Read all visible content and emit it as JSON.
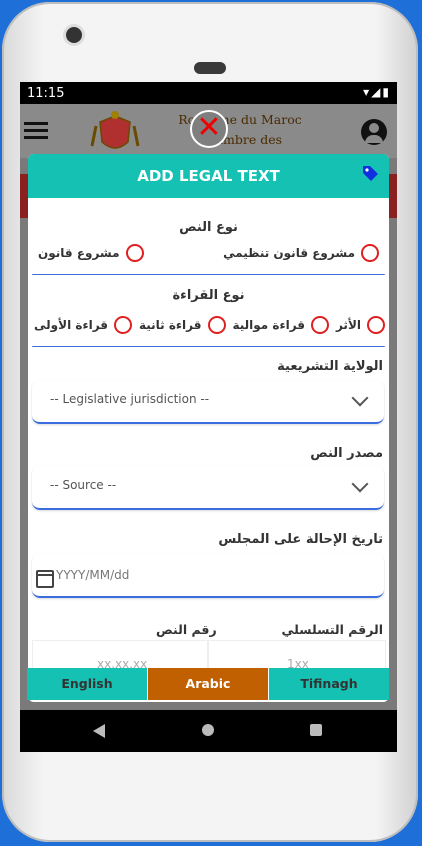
{
  "status": {
    "time": "11:15",
    "icons": "▾◢▮"
  },
  "app": {
    "title_line1": "Royaume du Maroc",
    "title_line2": "Chambre des Représentants",
    "close_glyph": "✕"
  },
  "modal": {
    "title": "ADD LEGAL TEXT",
    "text_type": {
      "label": "نوع النص",
      "options": [
        "مشروع قانون تنظيمي",
        "مشروع قانون"
      ]
    },
    "reading_type": {
      "label": "نوع القراءة",
      "options": [
        "الأثر",
        "قراءة موالية",
        "قراءة ثانية",
        "قراءة الأولى"
      ]
    },
    "jurisdiction": {
      "label": "الولاية التشريعية",
      "placeholder": "-- Legislative jurisdiction --"
    },
    "source": {
      "label": "مصدر النص",
      "placeholder": "-- Source --"
    },
    "referral_date": {
      "label": "تاريخ الإحالة على المجلس",
      "placeholder": "YYYY/MM/dd"
    },
    "serial_number": {
      "label": "الرقم التسلسلي",
      "placeholder": "1xx"
    },
    "text_number": {
      "label": "رقم النص",
      "placeholder": "xx.xx.xx"
    }
  },
  "languages": [
    "English",
    "Arabic",
    "Tifinagh"
  ],
  "active_language": "Arabic",
  "colors": {
    "accent": "#14c1b3",
    "active_tab": "#c06000",
    "radio": "#e02020",
    "focus": "#3a6ee0"
  }
}
